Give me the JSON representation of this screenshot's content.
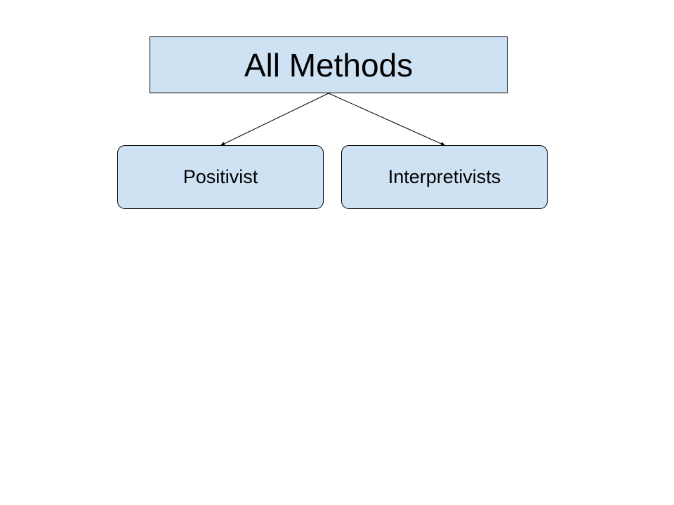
{
  "diagram": {
    "root": {
      "label": "All Methods"
    },
    "children": [
      {
        "label": "Positivist"
      },
      {
        "label": "Interpretivists"
      }
    ]
  },
  "colors": {
    "node_fill": "#cfe2f3",
    "border": "#000000",
    "connector": "#000000",
    "background": "#ffffff"
  }
}
